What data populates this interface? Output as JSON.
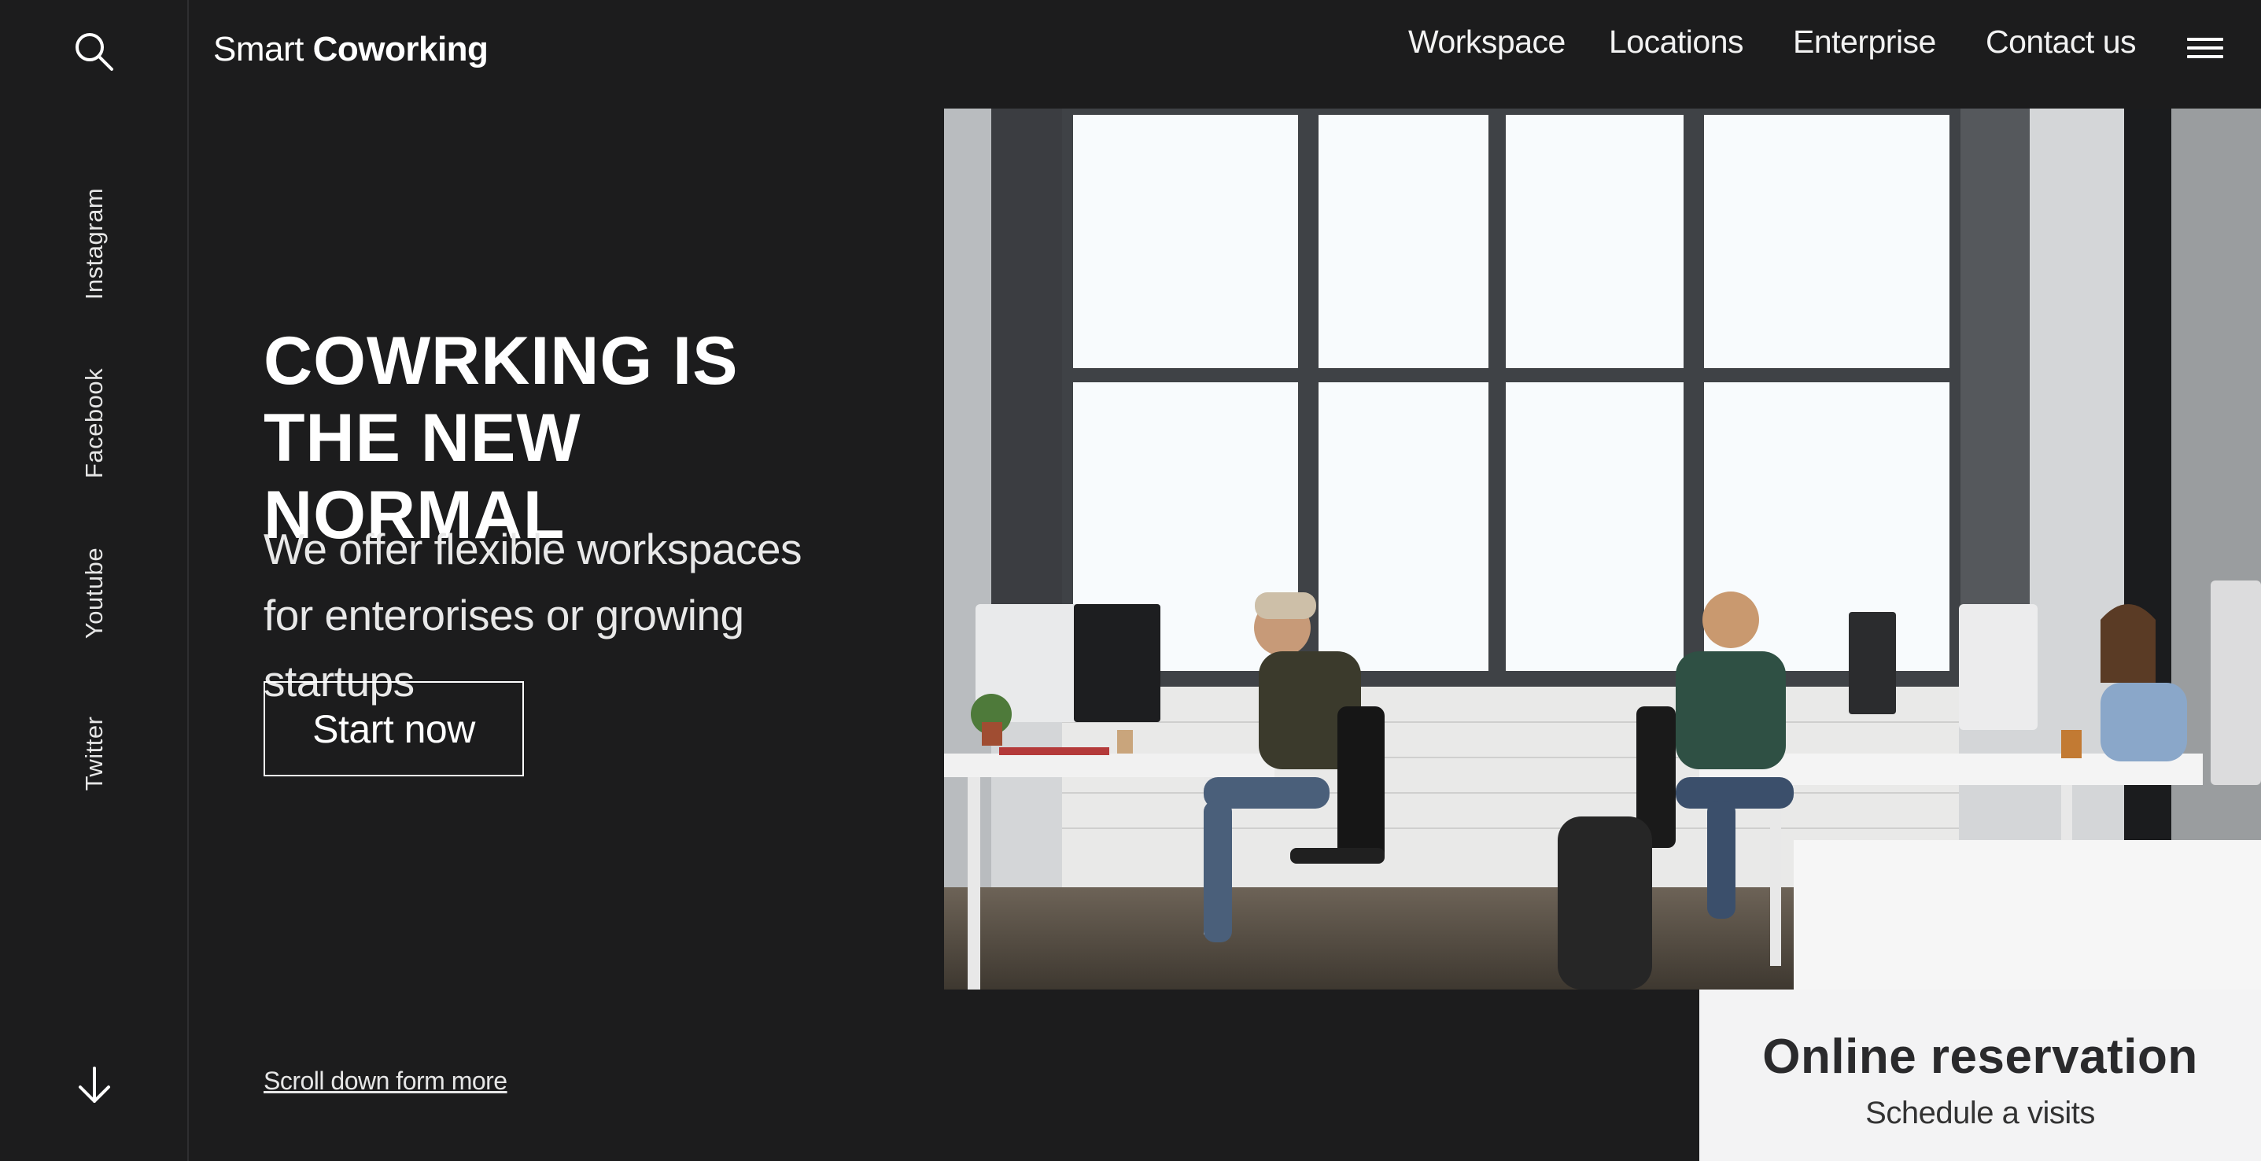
{
  "brand": {
    "light": "Smart",
    "bold": "Coworking"
  },
  "nav": [
    {
      "label": "Workspace"
    },
    {
      "label": "Locations"
    },
    {
      "label": "Enterprise"
    },
    {
      "label": "Contact us"
    }
  ],
  "social": [
    {
      "label": "Instagram"
    },
    {
      "label": "Facebook"
    },
    {
      "label": "Youtube"
    },
    {
      "label": "Twitter"
    }
  ],
  "hero": {
    "headline": "COWRKING IS THE NEW NORMAL",
    "subheadline": "We offer flexible workspaces for enterorises or growing startups",
    "cta_label": "Start now",
    "scroll_label": "Scroll down form more"
  },
  "reservation": {
    "title": "Online reservation",
    "caption": "Schedule a visits"
  },
  "icons": {
    "search": "search-icon",
    "menu": "hamburger-menu-icon",
    "arrow": "arrow-down-icon"
  },
  "colors": {
    "background": "#1c1c1d",
    "text": "#ffffff",
    "card": "#f3f3f4"
  }
}
